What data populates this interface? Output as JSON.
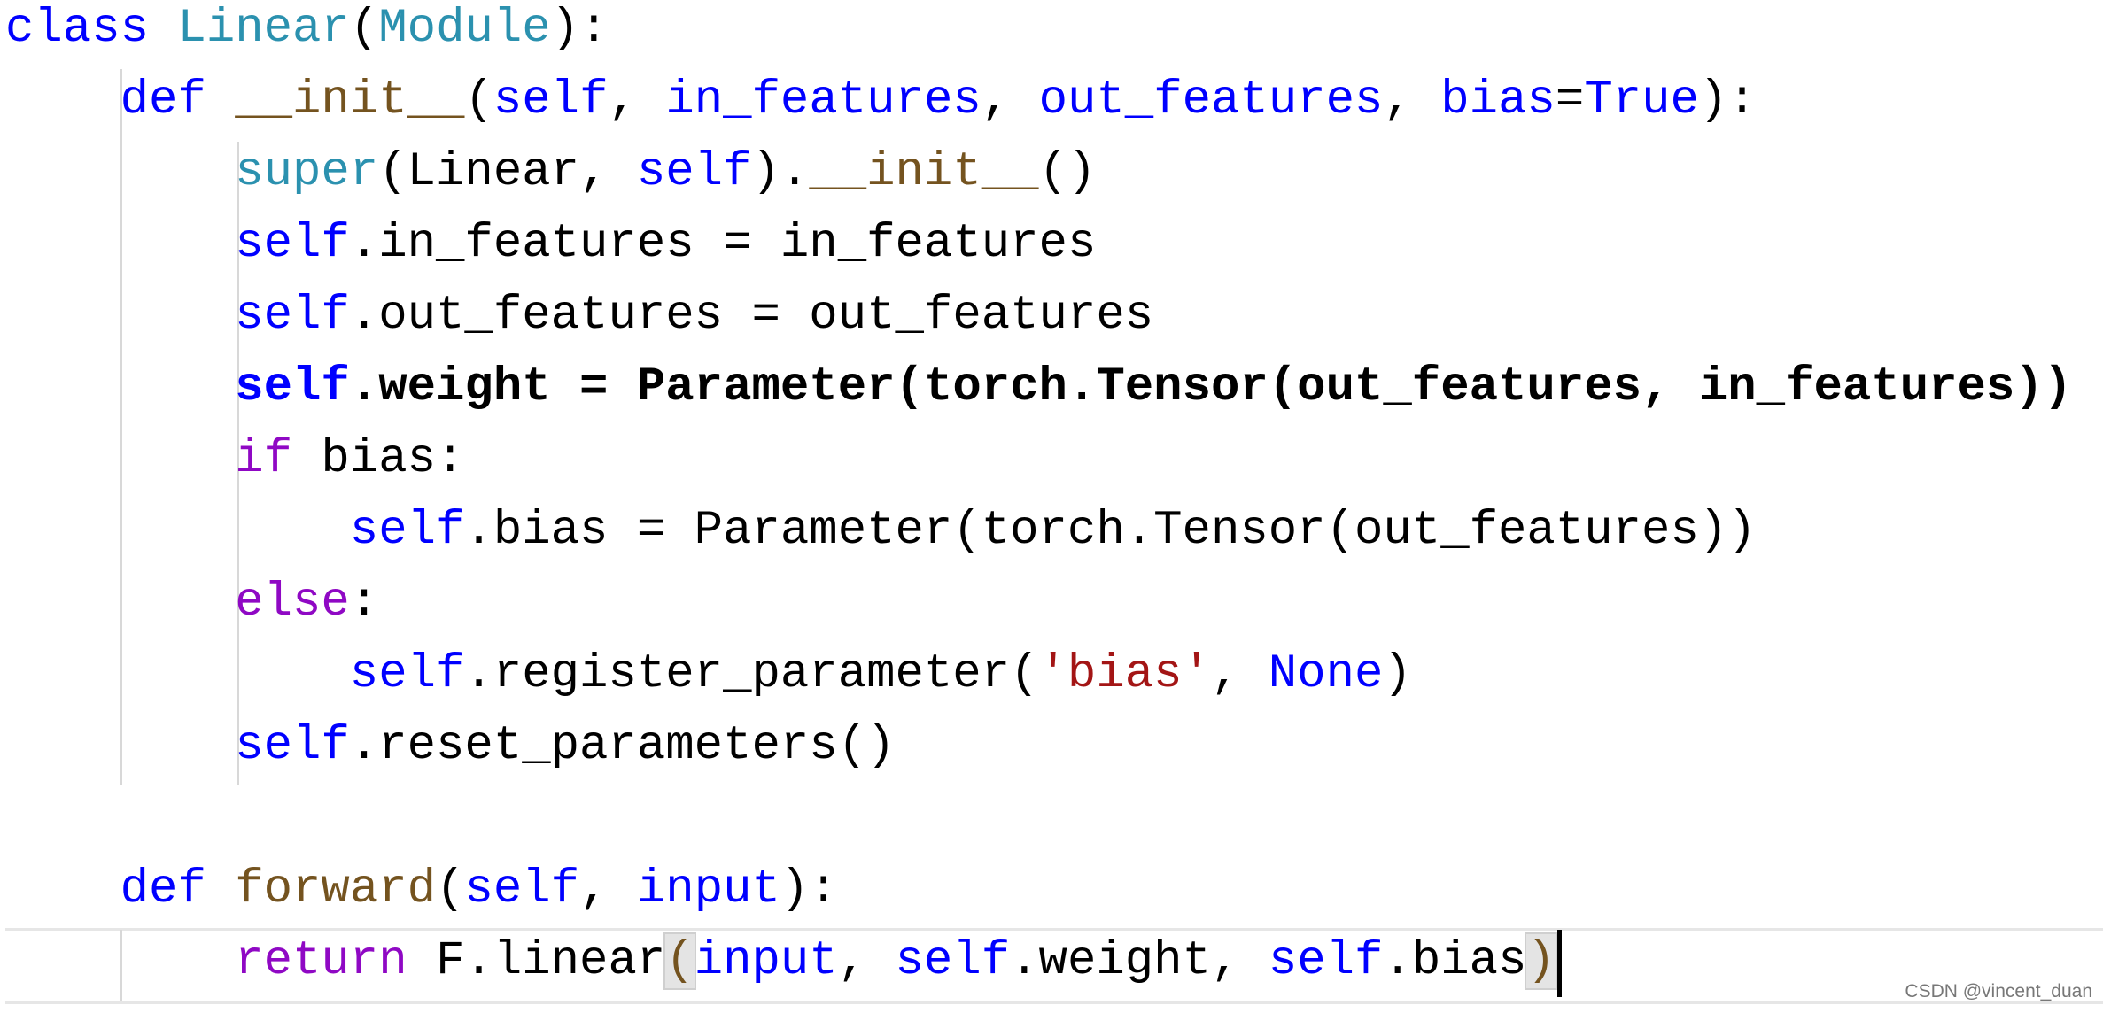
{
  "code": {
    "lines": [
      {
        "indent": 0,
        "tokens": [
          {
            "t": "class ",
            "c": "kw"
          },
          {
            "t": "Linear",
            "c": "cls"
          },
          {
            "t": "(",
            "c": "txt"
          },
          {
            "t": "Module",
            "c": "cls"
          },
          {
            "t": "):",
            "c": "txt"
          }
        ]
      },
      {
        "indent": 4,
        "tokens": [
          {
            "t": "def ",
            "c": "kw"
          },
          {
            "t": "__init__",
            "c": "fn"
          },
          {
            "t": "(",
            "c": "txt"
          },
          {
            "t": "self",
            "c": "kw"
          },
          {
            "t": ", ",
            "c": "txt"
          },
          {
            "t": "in_features",
            "c": "kw"
          },
          {
            "t": ", ",
            "c": "txt"
          },
          {
            "t": "out_features",
            "c": "kw"
          },
          {
            "t": ", ",
            "c": "txt"
          },
          {
            "t": "bias",
            "c": "kw"
          },
          {
            "t": "=",
            "c": "txt"
          },
          {
            "t": "True",
            "c": "kw"
          },
          {
            "t": "):",
            "c": "txt"
          }
        ]
      },
      {
        "indent": 8,
        "tokens": [
          {
            "t": "super",
            "c": "cls"
          },
          {
            "t": "(Linear, ",
            "c": "txt"
          },
          {
            "t": "self",
            "c": "kw"
          },
          {
            "t": ").",
            "c": "txt"
          },
          {
            "t": "__init__",
            "c": "fn"
          },
          {
            "t": "()",
            "c": "txt"
          }
        ]
      },
      {
        "indent": 8,
        "tokens": [
          {
            "t": "self",
            "c": "kw"
          },
          {
            "t": ".in_features = in_features",
            "c": "txt"
          }
        ]
      },
      {
        "indent": 8,
        "tokens": [
          {
            "t": "self",
            "c": "kw"
          },
          {
            "t": ".out_features = out_features",
            "c": "txt"
          }
        ]
      },
      {
        "indent": 8,
        "bold": true,
        "tokens": [
          {
            "t": "self",
            "c": "kw"
          },
          {
            "t": ".weight = Parameter(torch.Tensor(out_features, in_features))",
            "c": "txt"
          }
        ]
      },
      {
        "indent": 8,
        "tokens": [
          {
            "t": "if",
            "c": "ctl"
          },
          {
            "t": " bias:",
            "c": "txt"
          }
        ]
      },
      {
        "indent": 12,
        "tokens": [
          {
            "t": "self",
            "c": "kw"
          },
          {
            "t": ".bias = Parameter(torch.Tensor(out_features))",
            "c": "txt"
          }
        ]
      },
      {
        "indent": 8,
        "tokens": [
          {
            "t": "else",
            "c": "ctl"
          },
          {
            "t": ":",
            "c": "txt"
          }
        ]
      },
      {
        "indent": 12,
        "tokens": [
          {
            "t": "self",
            "c": "kw"
          },
          {
            "t": ".register_parameter(",
            "c": "txt"
          },
          {
            "t": "'bias'",
            "c": "str"
          },
          {
            "t": ", ",
            "c": "txt"
          },
          {
            "t": "None",
            "c": "kw"
          },
          {
            "t": ")",
            "c": "txt"
          }
        ]
      },
      {
        "indent": 8,
        "tokens": [
          {
            "t": "self",
            "c": "kw"
          },
          {
            "t": ".reset_parameters()",
            "c": "txt"
          }
        ]
      },
      {
        "indent": 0,
        "tokens": []
      },
      {
        "indent": 4,
        "tokens": [
          {
            "t": "def ",
            "c": "kw"
          },
          {
            "t": "forward",
            "c": "fn"
          },
          {
            "t": "(",
            "c": "txt"
          },
          {
            "t": "self",
            "c": "kw"
          },
          {
            "t": ", ",
            "c": "txt"
          },
          {
            "t": "input",
            "c": "kw"
          },
          {
            "t": "):",
            "c": "txt"
          }
        ]
      },
      {
        "indent": 8,
        "tokens": [
          {
            "t": "return",
            "c": "ctl"
          },
          {
            "t": " F.linear",
            "c": "txt"
          },
          {
            "t": "(",
            "c": "bracket"
          },
          {
            "t": "input",
            "c": "kw"
          },
          {
            "t": ", ",
            "c": "txt"
          },
          {
            "t": "self",
            "c": "kw"
          },
          {
            "t": ".weight, ",
            "c": "txt"
          },
          {
            "t": "self",
            "c": "kw"
          },
          {
            "t": ".bias",
            "c": "txt"
          },
          {
            "t": ")",
            "c": "bracket"
          }
        ]
      }
    ]
  },
  "colors": {
    "keyword": "#0000ff",
    "type": "#2b91af",
    "function": "#74531f",
    "string": "#a31515",
    "control": "#8f08c4"
  },
  "watermark": "CSDN @vincent_duan"
}
